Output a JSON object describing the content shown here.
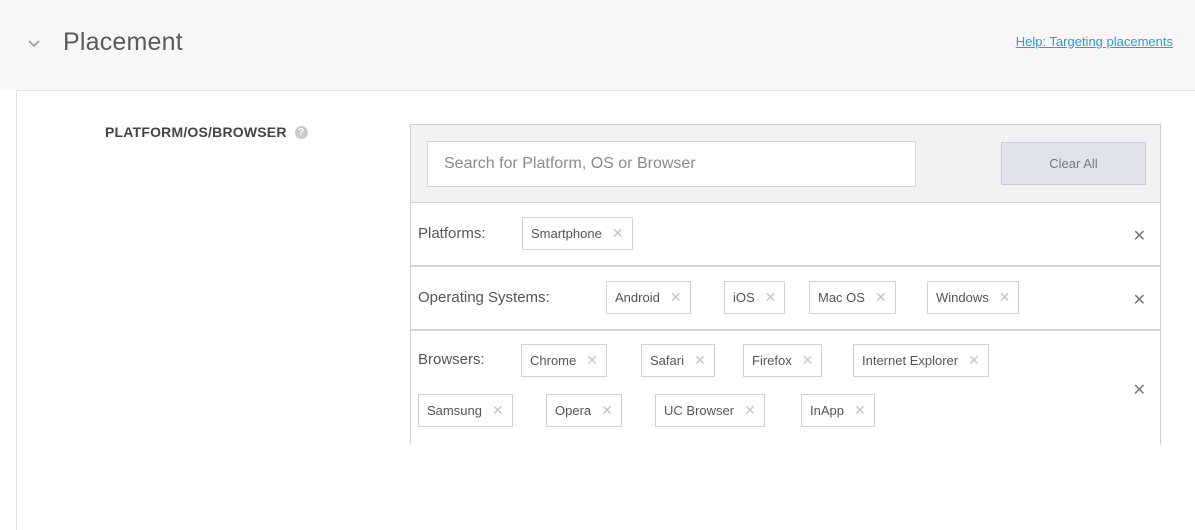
{
  "section": {
    "title": "Placement",
    "help_link": "Help: Targeting placements"
  },
  "field": {
    "label": "PLATFORM/OS/BROWSER",
    "help_icon": "?"
  },
  "search": {
    "placeholder": "Search for Platform, OS or Browser",
    "value": ""
  },
  "clear_all_label": "Clear All",
  "remove_glyph": "✕",
  "rows": {
    "platforms": {
      "label": "Platforms:",
      "chips": [
        "Smartphone"
      ]
    },
    "operating_systems": {
      "label": "Operating Systems:",
      "chips": [
        "Android",
        "iOS",
        "Mac OS",
        "Windows"
      ]
    },
    "browsers": {
      "label": "Browsers:",
      "chips": [
        "Chrome",
        "Safari",
        "Firefox",
        "Internet Explorer",
        "Samsung",
        "Opera",
        "UC Browser",
        "InApp"
      ]
    }
  },
  "icons": {
    "collapse": "chevron-down-icon",
    "help": "question-circle-icon",
    "remove": "close-icon"
  }
}
